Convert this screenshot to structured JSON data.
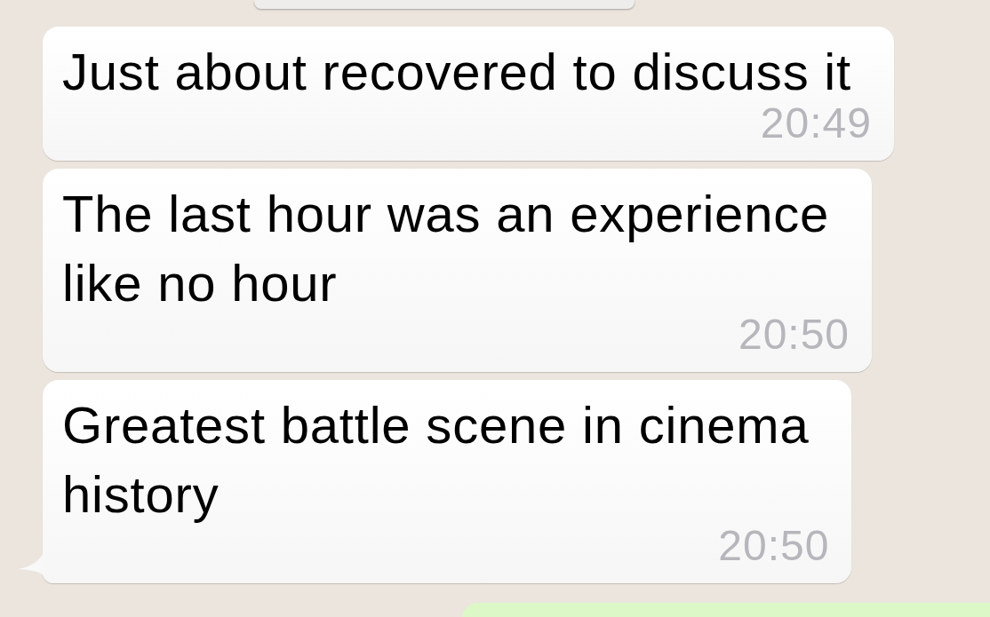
{
  "messages": [
    {
      "kind": "notice"
    },
    {
      "kind": "incoming",
      "lines": [
        "Just about recovered to discuss it"
      ],
      "time": "20:49",
      "tail": false
    },
    {
      "kind": "incoming",
      "lines": [
        "The last hour was an experience",
        "like no hour"
      ],
      "time": "20:50",
      "tail": false
    },
    {
      "kind": "incoming",
      "lines": [
        "Greatest battle scene in cinema",
        "history"
      ],
      "time": "20:50",
      "tail": true
    },
    {
      "kind": "outgoing"
    }
  ]
}
